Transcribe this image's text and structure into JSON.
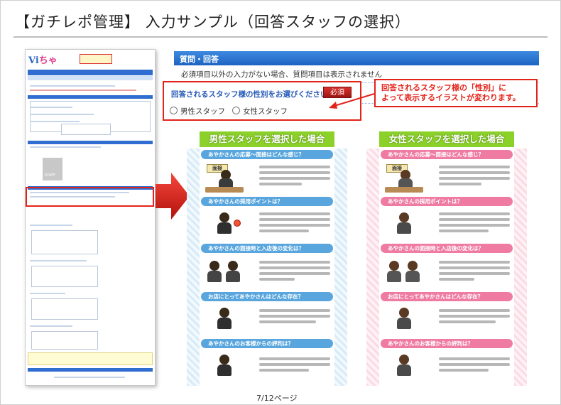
{
  "slide": {
    "title": "【ガチレポ管理】 入力サンプル（回答スタッフの選択）",
    "page_number": "7/12ページ"
  },
  "thumbnail": {
    "logo_part1": "Vi",
    "logo_part2": "ちゃ",
    "staff_label": "STAFF"
  },
  "qa_panel": {
    "header": "質問・回答",
    "note": "必須項目以外の入力がない場合、質問項目は表示されません",
    "question_label": "回答されるスタッフ様の性別をお選びください",
    "required_badge": "必須",
    "options": [
      "男性スタッフ",
      "女性スタッフ"
    ]
  },
  "callout": {
    "line1": "回答されるスタッフ様の「性別」に",
    "line2": "よって表示するイラストが変わります。"
  },
  "columns": {
    "male": {
      "title": "男性スタッフを選択した場合",
      "sections": [
        "あやかさんの応募～面接はどんな感じ？",
        "あやかさんの採用ポイントは？",
        "あやかさんの面接時と入店後の変化は？",
        "お店にとってあやかさんはどんな存在？",
        "あやかさんのお客様からの評判は？"
      ],
      "sign_text": "面接"
    },
    "female": {
      "title": "女性スタッフを選択した場合",
      "sections": [
        "あやかさんの応募～面接はどんな感じ？",
        "あやかさんの採用ポイントは？",
        "あやかさんの面接時と入店後の変化は？",
        "お店にとってあやかさんはどんな存在？",
        "あやかさんのお客様からの評判は？"
      ],
      "sign_text": "面接"
    }
  },
  "colors": {
    "accent_red": "#e2231a",
    "header_blue": "#1d63c2",
    "title_green": "#8bd12a",
    "male_section": "#58a6dd",
    "female_section": "#ef7ba2"
  }
}
